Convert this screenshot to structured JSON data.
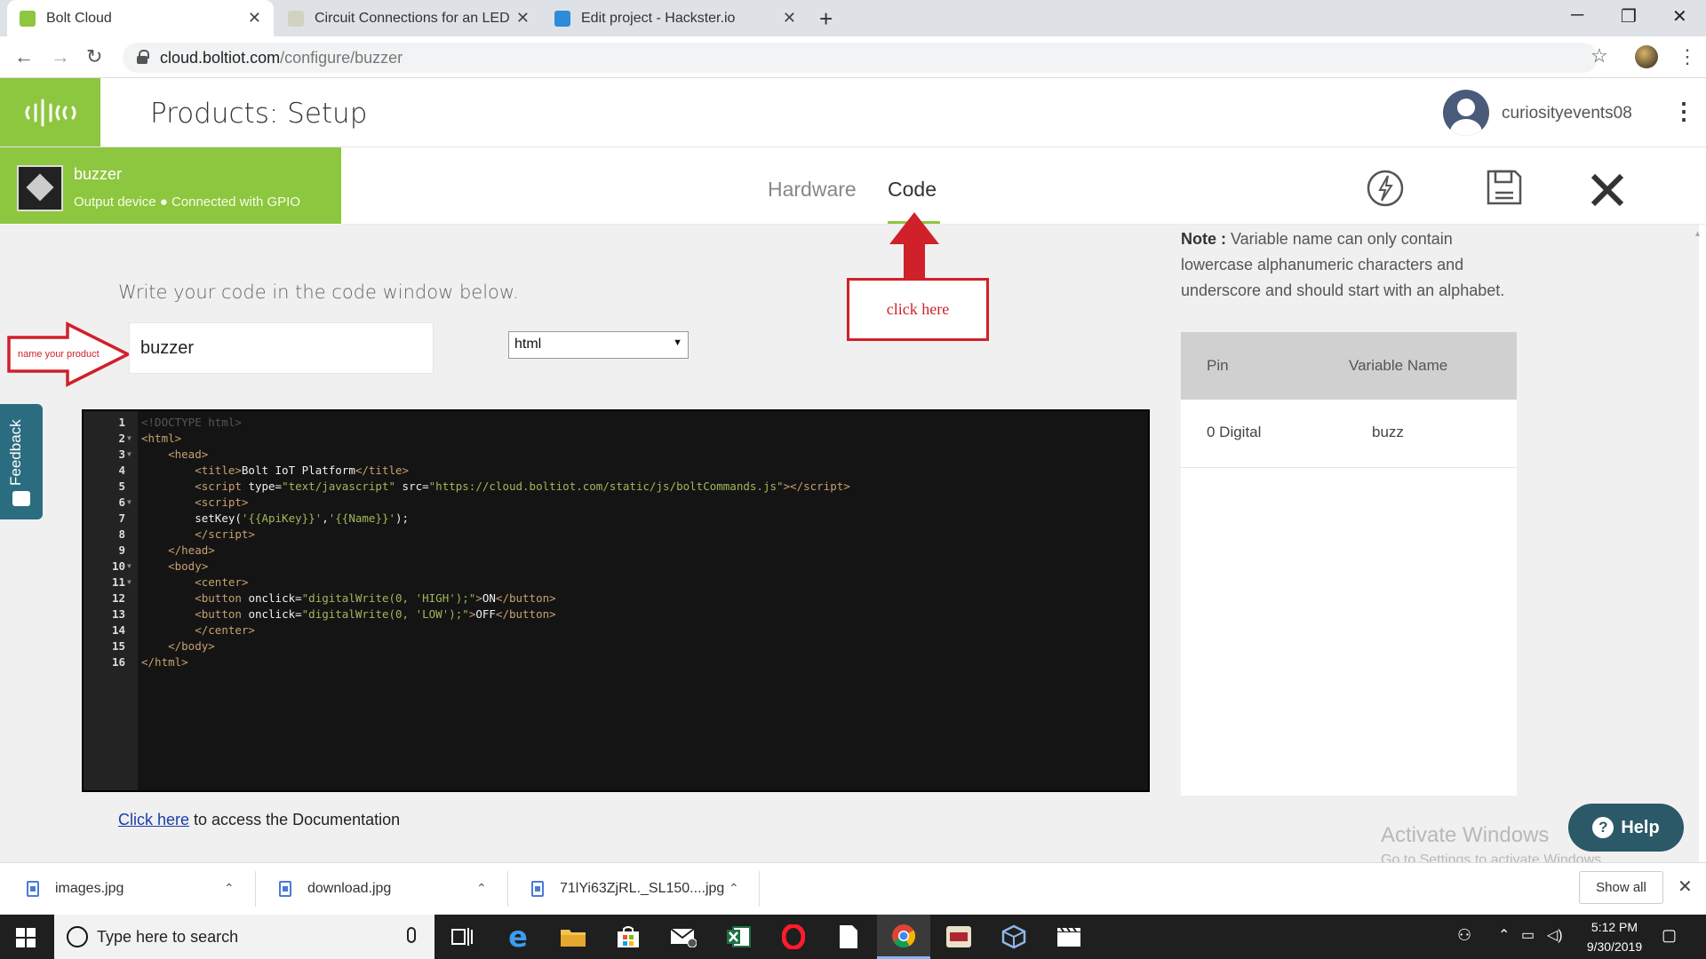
{
  "browser": {
    "tabs": [
      {
        "title": "Bolt Cloud",
        "active": true
      },
      {
        "title": "Circuit Connections for an LED | E",
        "active": false
      },
      {
        "title": "Edit project - Hackster.io",
        "active": false
      }
    ],
    "url_host": "cloud.boltiot.com",
    "url_path": "/configure/buzzer"
  },
  "header": {
    "title": "Products: Setup",
    "username": "curiosityevents08"
  },
  "product": {
    "name": "buzzer",
    "description": "Output device ● Connected with GPIO"
  },
  "tabs": {
    "hardware": "Hardware",
    "code": "Code"
  },
  "main": {
    "intro": "Write your code in the code window below.",
    "product_name_value": "buzzer",
    "language": "html",
    "doc_link": "Click here",
    "doc_rest": " to access the Documentation"
  },
  "annotations": {
    "name_arrow": "name your product",
    "click_box": "click here"
  },
  "feedback": "Feedback",
  "code": {
    "lines": [
      {
        "n": "1",
        "fold": "",
        "html": "<span class=\"c\">&lt;!DOCTYPE html&gt;</span>"
      },
      {
        "n": "2",
        "fold": "▼",
        "html": "<span class=\"t\">&lt;html&gt;</span>"
      },
      {
        "n": "3",
        "fold": "▼",
        "html": "    <span class=\"t\">&lt;head&gt;</span>"
      },
      {
        "n": "4",
        "fold": "",
        "html": "        <span class=\"t\">&lt;title&gt;</span><span class=\"x\">Bolt IoT Platform</span><span class=\"t\">&lt;/title&gt;</span>"
      },
      {
        "n": "5",
        "fold": "",
        "html": "        <span class=\"t\">&lt;script </span><span class=\"a\">type=</span><span class=\"s\">\"text/javascript\"</span> <span class=\"a\">src=</span><span class=\"s\">\"https://cloud.boltiot.com/static/js/boltCommands.js\"</span><span class=\"t\">&gt;&lt;/script&gt;</span>"
      },
      {
        "n": "6",
        "fold": "▼",
        "html": "        <span class=\"t\">&lt;script&gt;</span>"
      },
      {
        "n": "7",
        "fold": "",
        "html": "        <span class=\"x\">setKey(</span><span class=\"s\">'{{ApiKey}}'</span><span class=\"x\">,</span><span class=\"s\">'{{Name}}'</span><span class=\"x\">);</span>"
      },
      {
        "n": "8",
        "fold": "",
        "html": "        <span class=\"t\">&lt;/script&gt;</span>"
      },
      {
        "n": "9",
        "fold": "",
        "html": "    <span class=\"t\">&lt;/head&gt;</span>"
      },
      {
        "n": "10",
        "fold": "▼",
        "html": "    <span class=\"t\">&lt;body&gt;</span>"
      },
      {
        "n": "11",
        "fold": "▼",
        "html": "        <span class=\"t\">&lt;center&gt;</span>"
      },
      {
        "n": "12",
        "fold": "",
        "html": "        <span class=\"t\">&lt;button </span><span class=\"a\">onclick=</span><span class=\"s\">\"digitalWrite(0, 'HIGH');\"</span><span class=\"t\">&gt;</span><span class=\"x\">ON</span><span class=\"t\">&lt;/button&gt;</span>"
      },
      {
        "n": "13",
        "fold": "",
        "html": "        <span class=\"t\">&lt;button </span><span class=\"a\">onclick=</span><span class=\"s\">\"digitalWrite(0, 'LOW');\"</span><span class=\"t\">&gt;</span><span class=\"x\">OFF</span><span class=\"t\">&lt;/button&gt;</span>"
      },
      {
        "n": "14",
        "fold": "",
        "html": "        <span class=\"t\">&lt;/center&gt;</span>"
      },
      {
        "n": "15",
        "fold": "",
        "html": "    <span class=\"t\">&lt;/body&gt;</span>"
      },
      {
        "n": "16",
        "fold": "",
        "html": "<span class=\"t\">&lt;/html&gt;</span>"
      }
    ]
  },
  "right_panel": {
    "note_label": "Note :",
    "note_text": " Variable name can only contain lowercase alphanumeric characters and underscore and should start with an alphabet.",
    "col_pin": "Pin",
    "col_var": "Variable Name",
    "rows": [
      {
        "pin": "0 Digital",
        "var": "buzz"
      }
    ]
  },
  "help": "Help",
  "watermark": {
    "line1": "Activate Windows",
    "line2": "Go to Settings to activate Windows."
  },
  "downloads": {
    "items": [
      "images.jpg",
      "download.jpg",
      "71lYi63ZjRL._SL150....jpg"
    ],
    "show_all": "Show all"
  },
  "taskbar": {
    "search_placeholder": "Type here to search",
    "time": "5:12 PM",
    "date": "9/30/2019"
  },
  "colors": {
    "brand_green": "#8dc63f",
    "annotation_red": "#d0202a"
  }
}
